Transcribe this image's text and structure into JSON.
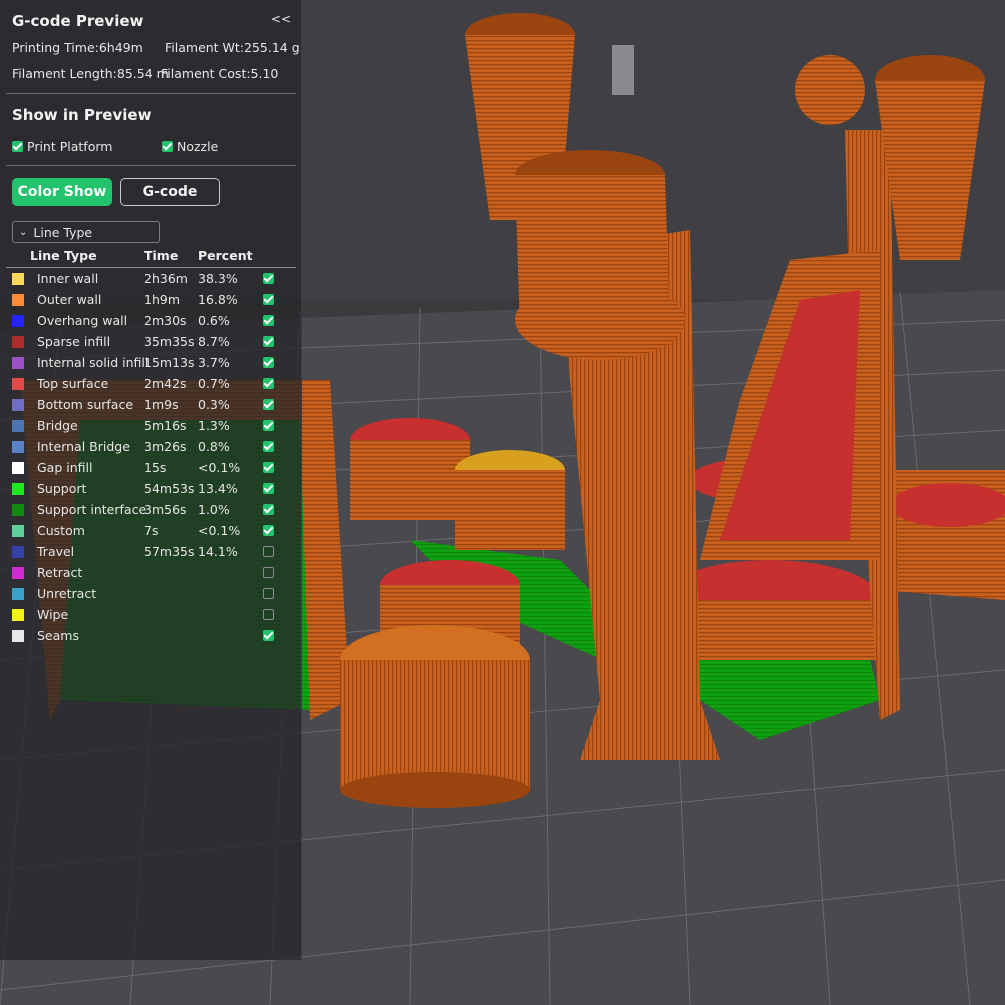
{
  "panel": {
    "title": "G-code Preview",
    "collapse_label": "<<",
    "stats": {
      "printing_time": "Printing Time:6h49m",
      "filament_wt": "Filament Wt:255.14 g",
      "filament_length": "Filament Length:85.54 m",
      "filament_cost": "Filament Cost:5.10"
    },
    "show_in_preview": {
      "title": "Show in Preview",
      "print_platform": {
        "label": "Print Platform",
        "checked": true
      },
      "nozzle": {
        "label": "Nozzle",
        "checked": true
      }
    },
    "buttons": {
      "color_show": "Color Show",
      "gcode": "G-code"
    },
    "view_type": "Line Type",
    "table": {
      "headers": {
        "type": "Line Type",
        "time": "Time",
        "percent": "Percent"
      },
      "rows": [
        {
          "name": "Inner wall",
          "time": "2h36m",
          "percent": "38.3%",
          "color": "#ffd95a",
          "visible": true
        },
        {
          "name": "Outer wall",
          "time": "1h9m",
          "percent": "16.8%",
          "color": "#ff8a33",
          "visible": true
        },
        {
          "name": "Overhang wall",
          "time": "2m30s",
          "percent": "0.6%",
          "color": "#2424ff",
          "visible": true
        },
        {
          "name": "Sparse infill",
          "time": "35m35s",
          "percent": "8.7%",
          "color": "#b02c2c",
          "visible": true
        },
        {
          "name": "Internal solid infill",
          "time": "15m13s",
          "percent": "3.7%",
          "color": "#9a52c6",
          "visible": true
        },
        {
          "name": "Top surface",
          "time": "2m42s",
          "percent": "0.7%",
          "color": "#e24a4a",
          "visible": true
        },
        {
          "name": "Bottom surface",
          "time": "1m9s",
          "percent": "0.3%",
          "color": "#6e6ec8",
          "visible": true
        },
        {
          "name": "Bridge",
          "time": "5m16s",
          "percent": "1.3%",
          "color": "#4f74b3",
          "visible": true
        },
        {
          "name": "Internal Bridge",
          "time": "3m26s",
          "percent": "0.8%",
          "color": "#5a82c8",
          "visible": true
        },
        {
          "name": "Gap infill",
          "time": "15s",
          "percent": "<0.1%",
          "color": "#ffffff",
          "visible": true
        },
        {
          "name": "Support",
          "time": "54m53s",
          "percent": "13.4%",
          "color": "#1ee81e",
          "visible": true
        },
        {
          "name": "Support interface",
          "time": "3m56s",
          "percent": "1.0%",
          "color": "#128a12",
          "visible": true
        },
        {
          "name": "Custom",
          "time": "7s",
          "percent": "<0.1%",
          "color": "#5ed29a",
          "visible": true
        },
        {
          "name": "Travel",
          "time": "57m35s",
          "percent": "14.1%",
          "color": "#353fa8",
          "visible": false
        },
        {
          "name": "Retract",
          "time": "",
          "percent": "",
          "color": "#d22ad2",
          "visible": false
        },
        {
          "name": "Unretract",
          "time": "",
          "percent": "",
          "color": "#3aa0c8",
          "visible": false
        },
        {
          "name": "Wipe",
          "time": "",
          "percent": "",
          "color": "#f2f21a",
          "visible": false
        },
        {
          "name": "Seams",
          "time": "",
          "percent": "",
          "color": "#e8e8e8",
          "visible": true
        }
      ]
    }
  },
  "colors": {
    "accent": "#23c26d",
    "outer_wall": "#c8601e",
    "support": "#1ea01e",
    "top_surface": "#c83030"
  }
}
